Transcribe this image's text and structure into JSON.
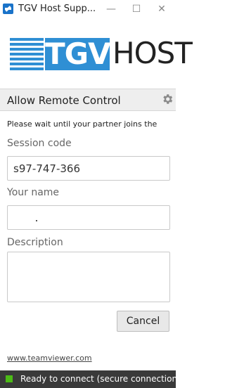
{
  "window": {
    "title": "TGV Host Supp...",
    "min_glyph": "—",
    "max_glyph": "☐",
    "close_glyph": "✕"
  },
  "logo": {
    "brand_box_text": "TGV",
    "brand_text": "HOST",
    "color": "#2f8fd4"
  },
  "section": {
    "title": "Allow Remote Control",
    "settings_icon": "gear-icon"
  },
  "message": "Please wait until your partner joins the",
  "form": {
    "session_label": "Session code",
    "session_value": "s97-747-366",
    "name_label": "Your name",
    "name_value": "",
    "description_label": "Description",
    "description_value": ""
  },
  "buttons": {
    "cancel": "Cancel"
  },
  "footer": {
    "link": "www.teamviewer.com"
  },
  "status": {
    "text": "Ready to connect (secure connection)",
    "indicator_color": "#4cbb17",
    "bar_color": "#3a3a3a"
  }
}
